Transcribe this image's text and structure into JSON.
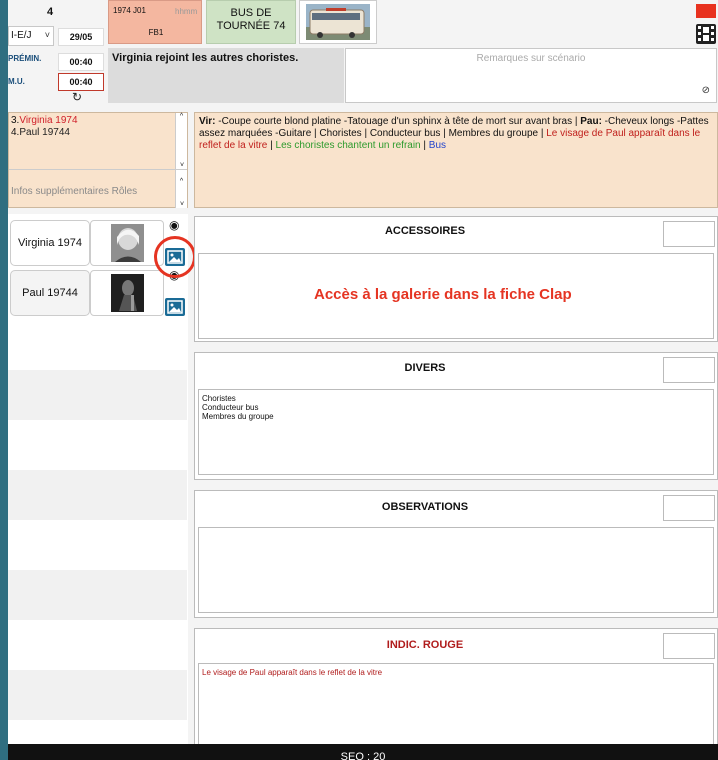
{
  "header": {
    "scene_number": "4",
    "interior_exterior": "I-E/J",
    "date": "29/05",
    "sequence_code": "1974 J01",
    "time_placeholder": "hhmm",
    "set_code": "FB1",
    "location": "BUS DE TOURNÉE 74",
    "premin_label": "PRÉMIN.",
    "premin_value": "00:40",
    "mu_label": "M.U.",
    "mu_value": "00:40",
    "summary": "Virginia rejoint les autres choristes.",
    "remarks_placeholder": "Remarques sur scénario"
  },
  "roles": {
    "list": [
      {
        "num": "3.",
        "name": "Virginia 1974",
        "color": "#d0202a"
      },
      {
        "num": "4.",
        "name": "Paul 19744",
        "color": "#222222"
      }
    ],
    "extra_placeholder": "Infos supplémentaires Rôles",
    "description": [
      {
        "text": "Vir:",
        "bold": true,
        "color": "#111111"
      },
      {
        "text": " -Coupe courte blond platine -Tatouage d'un sphinx à tête de mort sur avant bras | ",
        "bold": false,
        "color": "#111111"
      },
      {
        "text": "Pau:",
        "bold": true,
        "color": "#111111"
      },
      {
        "text": " -Cheveux longs -Pattes assez marquées -Guitare | Choristes | Conducteur bus | Membres du groupe | ",
        "bold": false,
        "color": "#111111"
      },
      {
        "text": "Le visage de Paul apparaît dans le reflet de la vitre",
        "bold": false,
        "color": "#c0201c"
      },
      {
        "text": " | ",
        "bold": false,
        "color": "#111111"
      },
      {
        "text": "Les choristes chantent un refrain",
        "bold": false,
        "color": "#2d9a2d"
      },
      {
        "text": " | ",
        "bold": false,
        "color": "#111111"
      },
      {
        "text": "Bus",
        "bold": false,
        "color": "#2244cc"
      }
    ]
  },
  "cast": [
    {
      "name": "Virginia 1974"
    },
    {
      "name": "Paul 19744"
    }
  ],
  "annotation": {
    "label": "Accès à la galerie dans la fiche Clap",
    "color": "#e53422"
  },
  "sections": {
    "accessoires": {
      "title": "ACCESSOIRES",
      "content": []
    },
    "divers": {
      "title": "DIVERS",
      "content": [
        "Choristes",
        "Conducteur bus",
        "Membres du groupe"
      ]
    },
    "observations": {
      "title": "OBSERVATIONS",
      "content": []
    },
    "indic_rouge": {
      "title": "INDIC. ROUGE",
      "content": [
        "Le visage de Paul apparaît dans le reflet de la vitre"
      ],
      "color": "#b01c1c"
    }
  },
  "footer": {
    "label": "SEQ : 20"
  },
  "colors": {
    "roles_bg": "#f9e3cc",
    "sequence_bg": "#f4b7a0",
    "location_bg": "#cfe3c5",
    "summary_bg": "#dcdcdc",
    "accent_blue": "#1a6b96"
  }
}
